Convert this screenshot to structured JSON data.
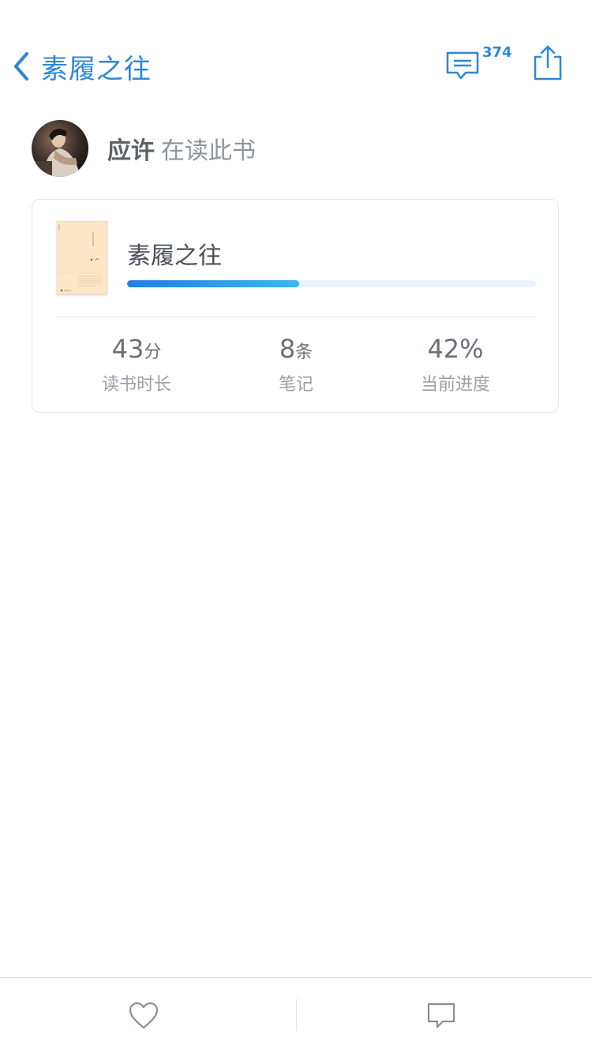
{
  "header": {
    "back_title": "素履之往",
    "comments_count": "374"
  },
  "reader": {
    "name": "应许",
    "status": "在读此书"
  },
  "book": {
    "title": "素履之往",
    "progress_fraction": 0.42
  },
  "stats": [
    {
      "value": "43",
      "unit": "分",
      "label": "读书时长"
    },
    {
      "value": "8",
      "unit": "条",
      "label": "笔记"
    },
    {
      "value": "42%",
      "unit": "",
      "label": "当前进度"
    }
  ],
  "colors": {
    "accent": "#2f86d9",
    "progress_start": "#1f7fe6",
    "progress_end": "#3ab6f4",
    "progress_track": "#eaf2fb",
    "cover": "#fde5c8"
  },
  "icons": {
    "back": "chevron-left-icon",
    "comments": "comment-lines-icon",
    "share": "share-icon",
    "like": "heart-icon",
    "comment": "speech-bubble-icon"
  }
}
